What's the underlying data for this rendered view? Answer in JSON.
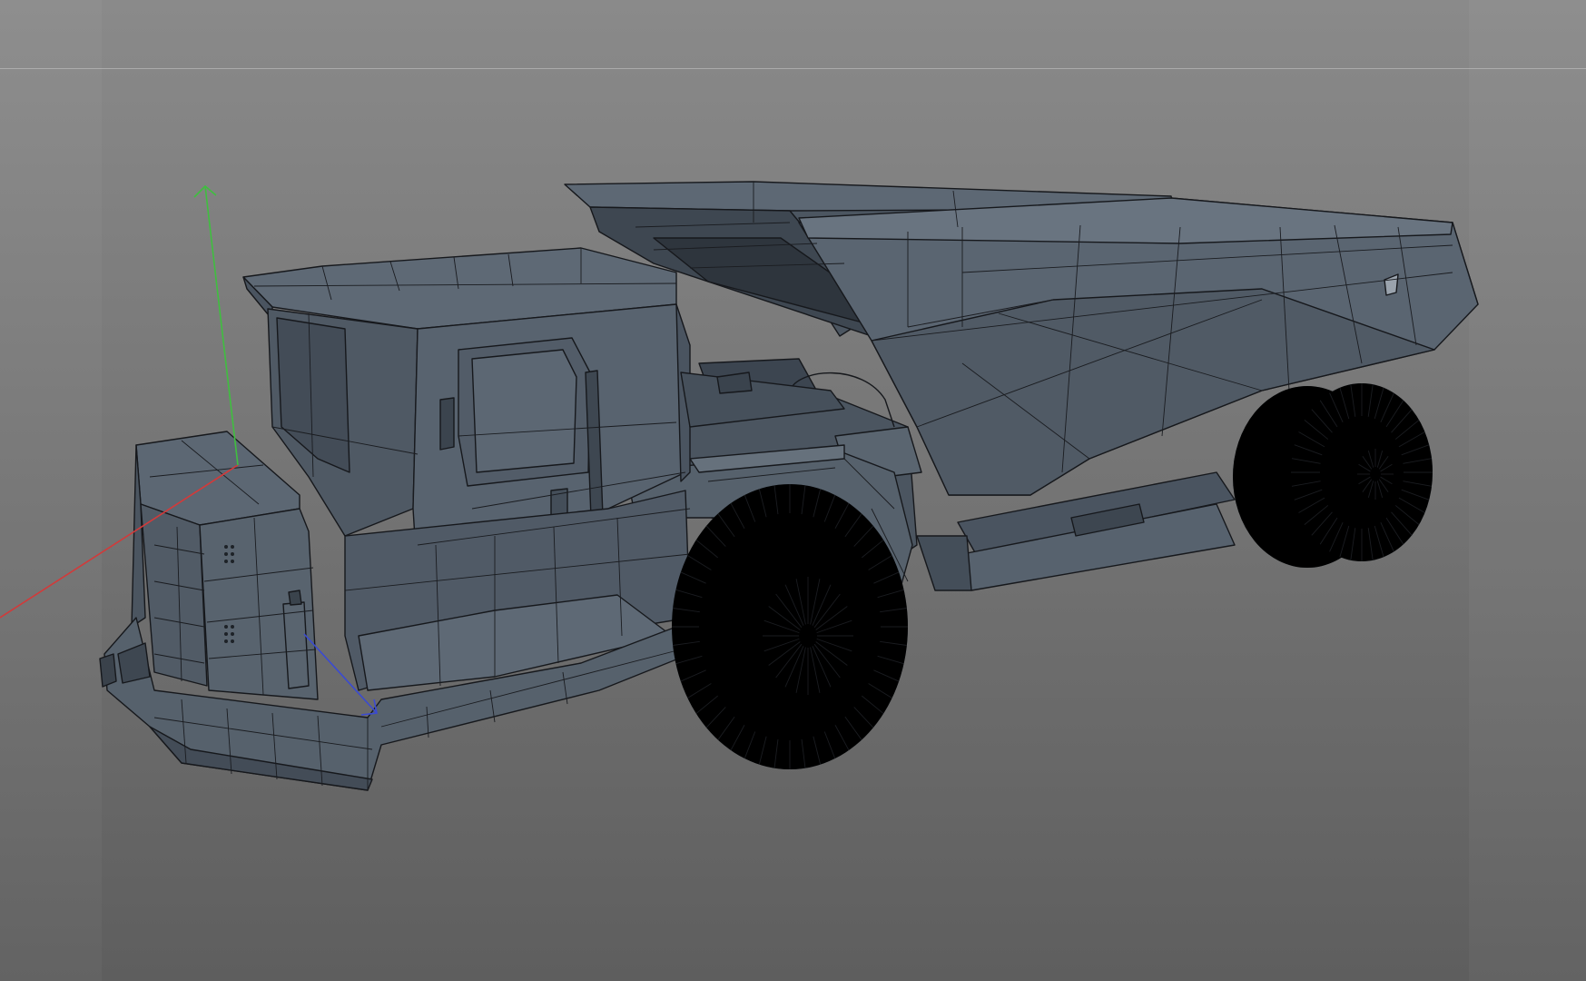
{
  "viewport": {
    "kind": "3d-perspective-view",
    "object": "articulated-dump-truck-mesh",
    "display_mode": "shaded-with-wireframe",
    "colors": {
      "background_top": "#8a8a8a",
      "background_bottom": "#5e5e5e",
      "mesh_face": "#55606c",
      "mesh_face_dark": "#414a55",
      "mesh_face_light": "#646f7b",
      "wire": "#16181c"
    }
  },
  "gizmo": {
    "icon": "axis-gizmo-icon",
    "axes": [
      {
        "axis": "x",
        "color": "#d23a3a"
      },
      {
        "axis": "y",
        "color": "#3fbf3f"
      },
      {
        "axis": "z",
        "color": "#3a4ad2"
      }
    ]
  }
}
